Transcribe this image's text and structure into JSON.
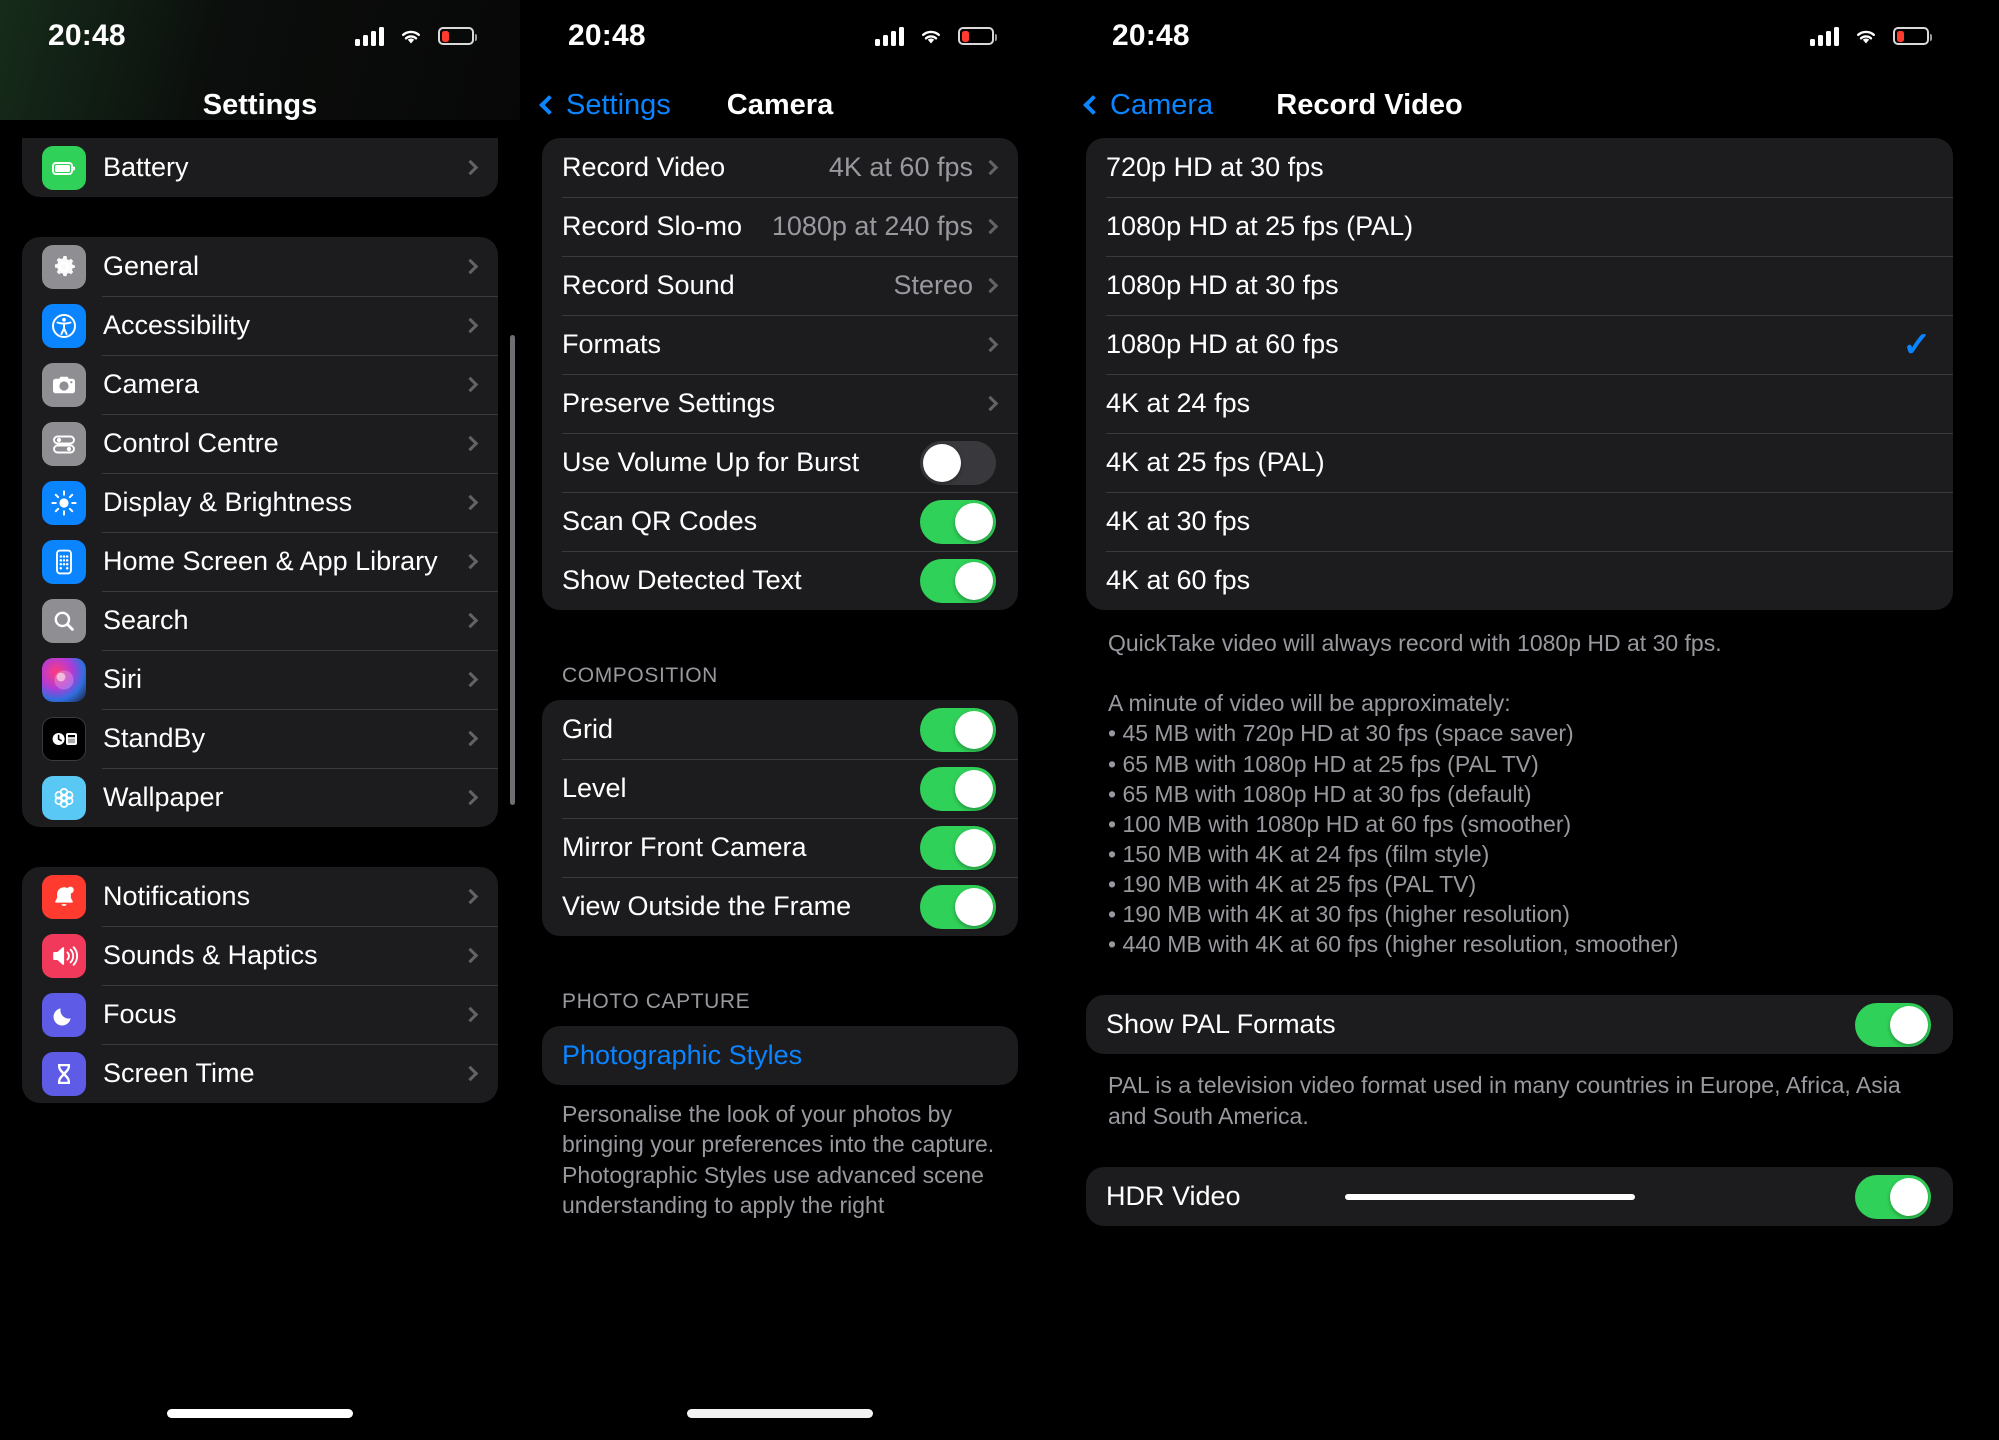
{
  "status_bar": {
    "time": "20:48"
  },
  "left_panel": {
    "title": "Settings",
    "top_partial_row": {
      "label": "Battery",
      "icon": "battery-icon"
    },
    "groups": [
      {
        "items": [
          {
            "label": "General",
            "icon": "gear-icon"
          },
          {
            "label": "Accessibility",
            "icon": "accessibility-icon"
          },
          {
            "label": "Camera",
            "icon": "camera-icon"
          },
          {
            "label": "Control Centre",
            "icon": "control-centre-icon"
          },
          {
            "label": "Display & Brightness",
            "icon": "brightness-icon"
          },
          {
            "label": "Home Screen & App Library",
            "icon": "home-screen-icon"
          },
          {
            "label": "Search",
            "icon": "search-icon"
          },
          {
            "label": "Siri",
            "icon": "siri-icon"
          },
          {
            "label": "StandBy",
            "icon": "standby-icon"
          },
          {
            "label": "Wallpaper",
            "icon": "wallpaper-icon"
          }
        ]
      },
      {
        "items": [
          {
            "label": "Notifications",
            "icon": "bell-icon"
          },
          {
            "label": "Sounds & Haptics",
            "icon": "speaker-icon"
          },
          {
            "label": "Focus",
            "icon": "moon-icon"
          },
          {
            "label": "Screen Time",
            "icon": "hourglass-icon"
          }
        ]
      }
    ]
  },
  "mid_panel": {
    "back_label": "Settings",
    "title": "Camera",
    "group_main": [
      {
        "label": "Record Video",
        "value": "4K at 60 fps",
        "type": "disclosure"
      },
      {
        "label": "Record Slo-mo",
        "value": "1080p at 240 fps",
        "type": "disclosure"
      },
      {
        "label": "Record Sound",
        "value": "Stereo",
        "type": "disclosure"
      },
      {
        "label": "Formats",
        "value": "",
        "type": "disclosure"
      },
      {
        "label": "Preserve Settings",
        "value": "",
        "type": "disclosure"
      },
      {
        "label": "Use Volume Up for Burst",
        "type": "toggle",
        "on": false
      },
      {
        "label": "Scan QR Codes",
        "type": "toggle",
        "on": true
      },
      {
        "label": "Show Detected Text",
        "type": "toggle",
        "on": true
      }
    ],
    "composition_header": "COMPOSITION",
    "group_composition": [
      {
        "label": "Grid",
        "type": "toggle",
        "on": true
      },
      {
        "label": "Level",
        "type": "toggle",
        "on": true
      },
      {
        "label": "Mirror Front Camera",
        "type": "toggle",
        "on": true
      },
      {
        "label": "View Outside the Frame",
        "type": "toggle",
        "on": true
      }
    ],
    "photo_capture_header": "PHOTO CAPTURE",
    "photographic_styles_label": "Photographic Styles",
    "photo_capture_footer": "Personalise the look of your photos by bringing your preferences into the capture. Photographic Styles use advanced scene understanding to apply the right"
  },
  "right_panel": {
    "back_label": "Camera",
    "title": "Record Video",
    "options": [
      {
        "label": "720p HD at 30 fps",
        "selected": false
      },
      {
        "label": "1080p HD at 25 fps (PAL)",
        "selected": false
      },
      {
        "label": "1080p HD at 30 fps",
        "selected": false
      },
      {
        "label": "1080p HD at 60 fps",
        "selected": true
      },
      {
        "label": "4K at 24 fps",
        "selected": false
      },
      {
        "label": "4K at 25 fps (PAL)",
        "selected": false
      },
      {
        "label": "4K at 30 fps",
        "selected": false
      },
      {
        "label": "4K at 60 fps",
        "selected": false
      }
    ],
    "options_footer": "QuickTake video will always record with 1080p HD at 30 fps.\n\nA minute of video will be approximately:\n• 45 MB with 720p HD at 30 fps (space saver)\n• 65 MB with 1080p HD at 25 fps (PAL TV)\n• 65 MB with 1080p HD at 30 fps (default)\n• 100 MB with 1080p HD at 60 fps (smoother)\n• 150 MB with 4K at 24 fps (film style)\n• 190 MB with 4K at 25 fps (PAL TV)\n• 190 MB with 4K at 30 fps (higher resolution)\n• 440 MB with 4K at 60 fps (higher resolution, smoother)",
    "pal_toggle": {
      "label": "Show PAL Formats",
      "on": true
    },
    "pal_footer": "PAL is a television video format used in many countries in Europe, Africa, Asia and South America.",
    "hdr_toggle": {
      "label": "HDR Video",
      "on": true
    }
  },
  "colors": {
    "accent_blue": "#0a84ff",
    "toggle_green": "#30d158",
    "card_bg": "#1c1c1e",
    "secondary_text": "#98989e",
    "battery_red": "#ff3b30"
  },
  "checkmark_glyph": "✓"
}
